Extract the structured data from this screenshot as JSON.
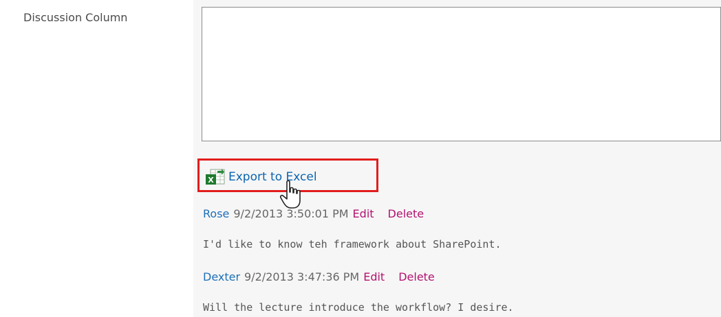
{
  "field": {
    "label": "Discussion Column",
    "textarea_value": ""
  },
  "toolbar": {
    "export_label": "Export to Excel",
    "export_icon": "excel-export-icon"
  },
  "comments": [
    {
      "author": "Rose",
      "timestamp": "9/2/2013 3:50:01 PM",
      "edit_label": "Edit",
      "delete_label": "Delete",
      "body": "I'd like to know teh framework about SharePoint."
    },
    {
      "author": "Dexter",
      "timestamp": "9/2/2013 3:47:36 PM",
      "edit_label": "Edit",
      "delete_label": "Delete",
      "body": "Will the lecture introduce the workflow? I desire."
    }
  ],
  "colors": {
    "highlight": "#e21d1d",
    "link": "#1d6fb8",
    "action": "#b3126f"
  }
}
